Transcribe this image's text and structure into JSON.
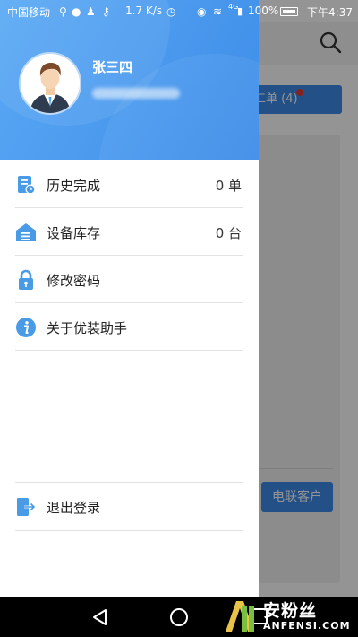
{
  "status_bar": {
    "carrier": "中国移动",
    "speed": "1.7 K/s",
    "signal": "4G",
    "battery": "100%",
    "time": "下午4:37"
  },
  "drawer": {
    "user": {
      "name": "张三四"
    },
    "menu": [
      {
        "label": "历史完成",
        "value": "0 单",
        "icon": "history-doc-icon"
      },
      {
        "label": "设备库存",
        "value": "0 台",
        "icon": "warehouse-icon"
      },
      {
        "label": "修改密码",
        "value": "",
        "icon": "lock-icon"
      },
      {
        "label": "关于优装助手",
        "value": "",
        "icon": "info-icon"
      }
    ],
    "logout": {
      "label": "退出登录",
      "icon": "logout-icon"
    }
  },
  "background": {
    "order_button": "工单 (4)",
    "customer_button": "电联客户"
  },
  "watermark": {
    "cn": "安粉丝",
    "en": "ANFENSI.COM"
  },
  "colors": {
    "accent": "#3d8ce8",
    "badge": "#e53935"
  }
}
